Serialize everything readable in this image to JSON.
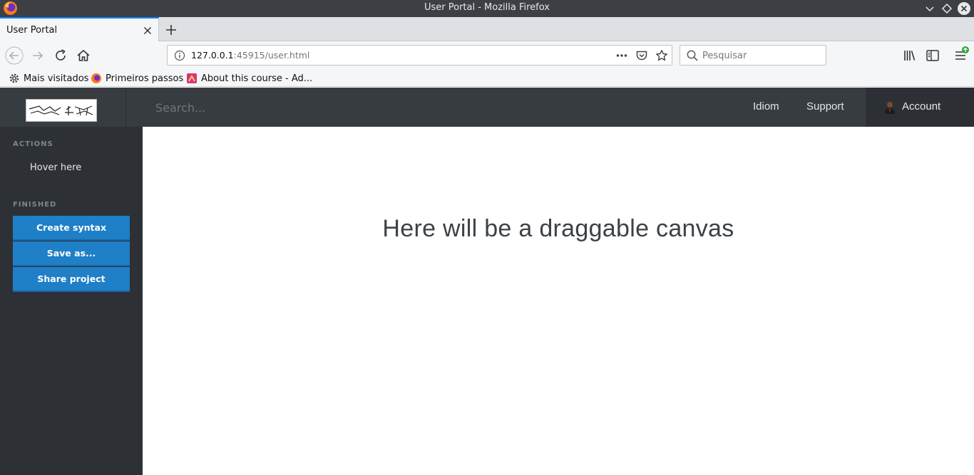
{
  "browser": {
    "window_title": "User Portal - Mozilla Firefox",
    "tab_label": "User Portal",
    "url_host": "127.0.0.1",
    "url_rest": ":45915/user.html",
    "search_placeholder": "Pesquisar",
    "bookmarks": [
      "Mais visitados",
      "Primeiros passos",
      "About this course - Ad..."
    ]
  },
  "header": {
    "search_placeholder": "Search...",
    "nav": [
      "Idiom",
      "Support"
    ],
    "account_label": "Account"
  },
  "sidebar": {
    "actions_title": "ACTIONS",
    "hover_link": "Hover here",
    "finished_title": "FINISHED",
    "buttons": [
      "Create syntax",
      "Save as...",
      "Share project"
    ]
  },
  "main": {
    "canvas_text": "Here will be a draggable canvas"
  },
  "colors": {
    "header_bg": "#373c41",
    "sidebar_bg": "#2d3136",
    "button_blue": "#1f7fc7"
  }
}
